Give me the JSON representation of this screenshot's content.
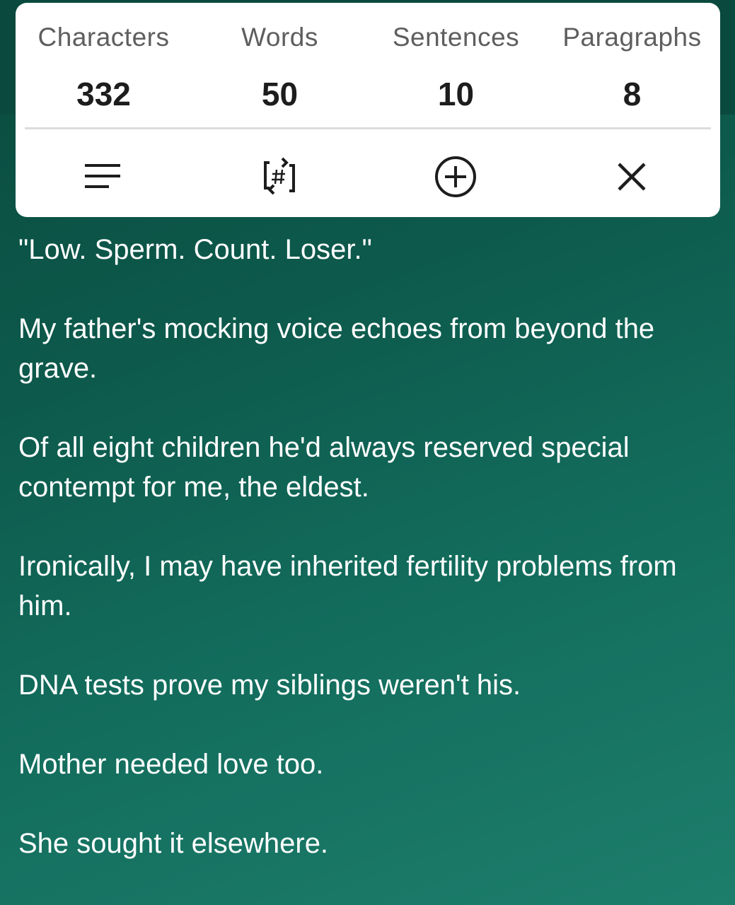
{
  "stats": [
    {
      "label": "Characters",
      "value": "332"
    },
    {
      "label": "Words",
      "value": "50"
    },
    {
      "label": "Sentences",
      "value": "10"
    },
    {
      "label": "Paragraphs",
      "value": "8"
    }
  ],
  "toolbar": {
    "icons": [
      "text-align-icon",
      "hash-counter-icon",
      "add-circle-icon",
      "close-icon"
    ]
  },
  "paragraphs": [
    "\"Low. Sperm. Count. Loser.\"",
    "My father's mocking voice echoes from beyond the grave.",
    "Of all eight children he'd always reserved special contempt for me, the eldest.",
    "Ironically, I may have inherited fertility problems from him.",
    "DNA tests prove my siblings weren't his.",
    "Mother needed love too.",
    "She sought it elsewhere."
  ],
  "colors": {
    "background_top": "#0a4a3e",
    "background_bottom": "#1d7e6c",
    "card": "#ffffff",
    "label_text": "#5e5e5e",
    "value_text": "#1d1d1d"
  }
}
